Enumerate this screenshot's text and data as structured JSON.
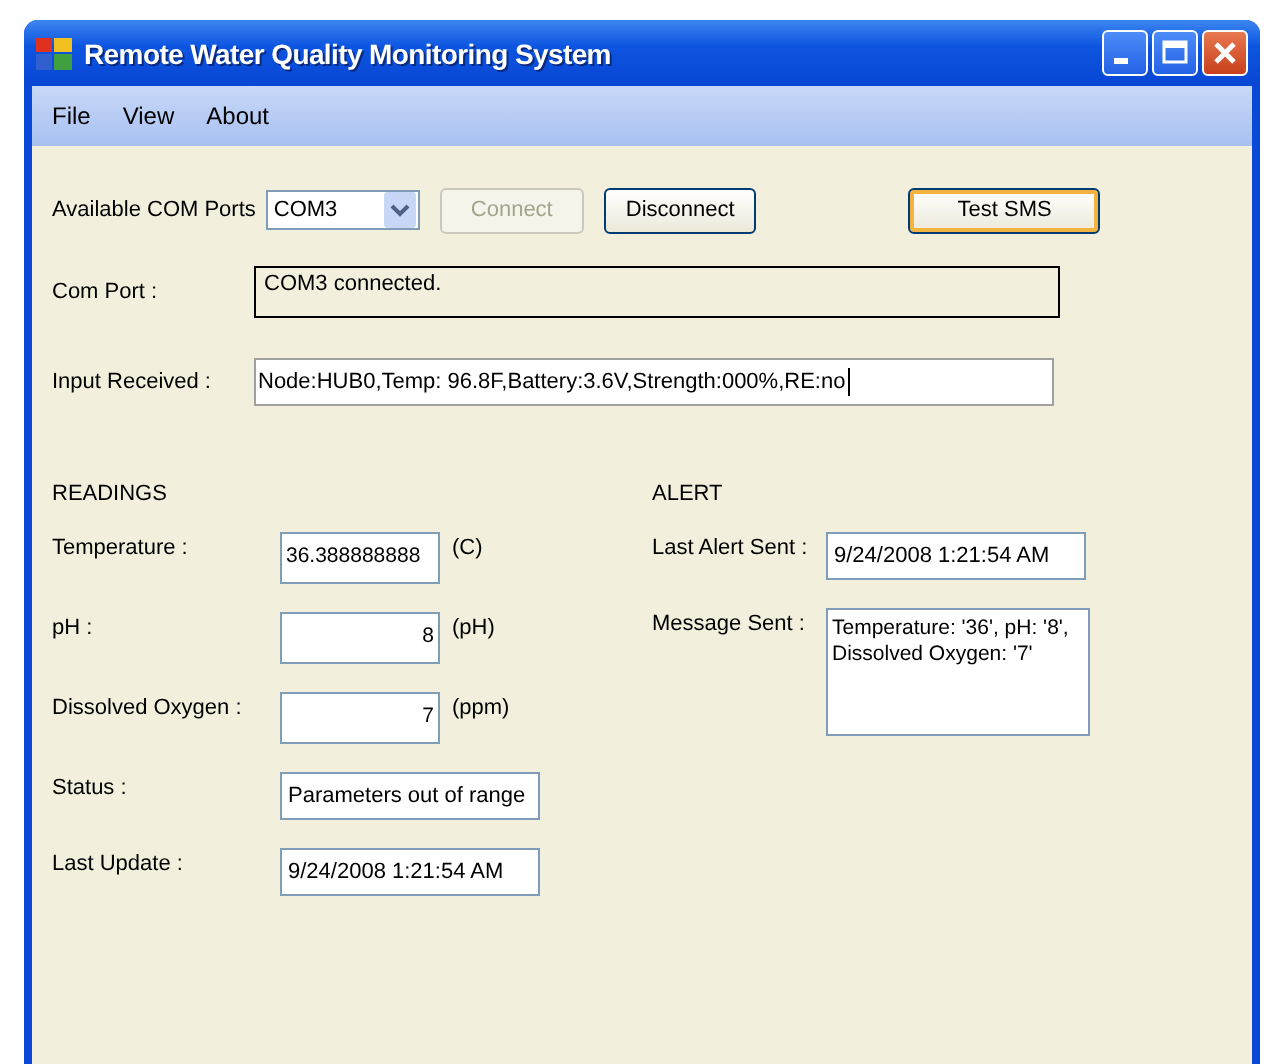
{
  "window": {
    "title": "Remote Water Quality Monitoring System"
  },
  "menu": [
    "File",
    "View",
    "About"
  ],
  "com_ports": {
    "label": "Available COM Ports",
    "value": "COM3"
  },
  "buttons": [
    {
      "label": "Connect",
      "disabled": true,
      "default": false
    },
    {
      "label": "Disconnect",
      "disabled": false,
      "default": false
    },
    {
      "label": "Test SMS",
      "disabled": false,
      "default": true
    }
  ],
  "com_port": {
    "label": "Com Port :",
    "value": "COM3 connected."
  },
  "input_received": {
    "label": "Input Received :",
    "value": "Node:HUB0,Temp: 96.8F,Battery:3.6V,Strength:000%,RE:no"
  },
  "readings": {
    "title": "READINGS",
    "fields": [
      {
        "label": "Temperature :",
        "value": "36.388888888",
        "unit": "(C)",
        "kind": "text"
      },
      {
        "label": "pH :",
        "value": "8",
        "unit": "(pH)",
        "kind": "number"
      },
      {
        "label": "Dissolved Oxygen :",
        "value": "7",
        "unit": "(ppm)",
        "kind": "number"
      },
      {
        "label": "Status :",
        "value": "Parameters out of range",
        "kind": "wide"
      },
      {
        "label": "Last Update :",
        "value": "9/24/2008 1:21:54 AM",
        "kind": "wide"
      }
    ]
  },
  "alert": {
    "title": "ALERT",
    "last_alert_sent": {
      "label": "Last Alert Sent :",
      "value": "9/24/2008 1:21:54 AM"
    },
    "message_sent": {
      "label": "Message Sent :",
      "value": "Temperature: '36', pH: '8', Dissolved Oxygen: '7'"
    }
  }
}
